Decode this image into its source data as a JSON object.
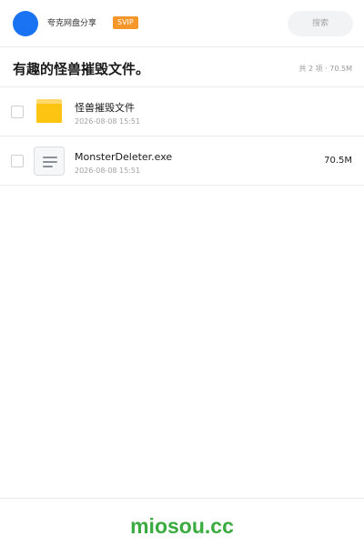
{
  "header": {
    "user_name": "夸克网盘分享",
    "badge": "SVIP",
    "search_placeholder": "搜索"
  },
  "share": {
    "title": "有趣的怪兽摧毁文件。",
    "meta": "共 2 项 · 70.5M"
  },
  "files": [
    {
      "name": "怪兽摧毁文件",
      "date": "2026-08-08 15:51",
      "size": "",
      "type": "folder"
    },
    {
      "name": "MonsterDeleter.exe",
      "date": "2026-08-08 15:51",
      "size": "70.5M",
      "type": "file"
    }
  ],
  "footer": {
    "brand": "miosou.cc"
  },
  "colors": {
    "avatar": "#1a73f2",
    "badge": "#f5962b",
    "folder": "#fdc512",
    "brand": "#3aab3f"
  }
}
